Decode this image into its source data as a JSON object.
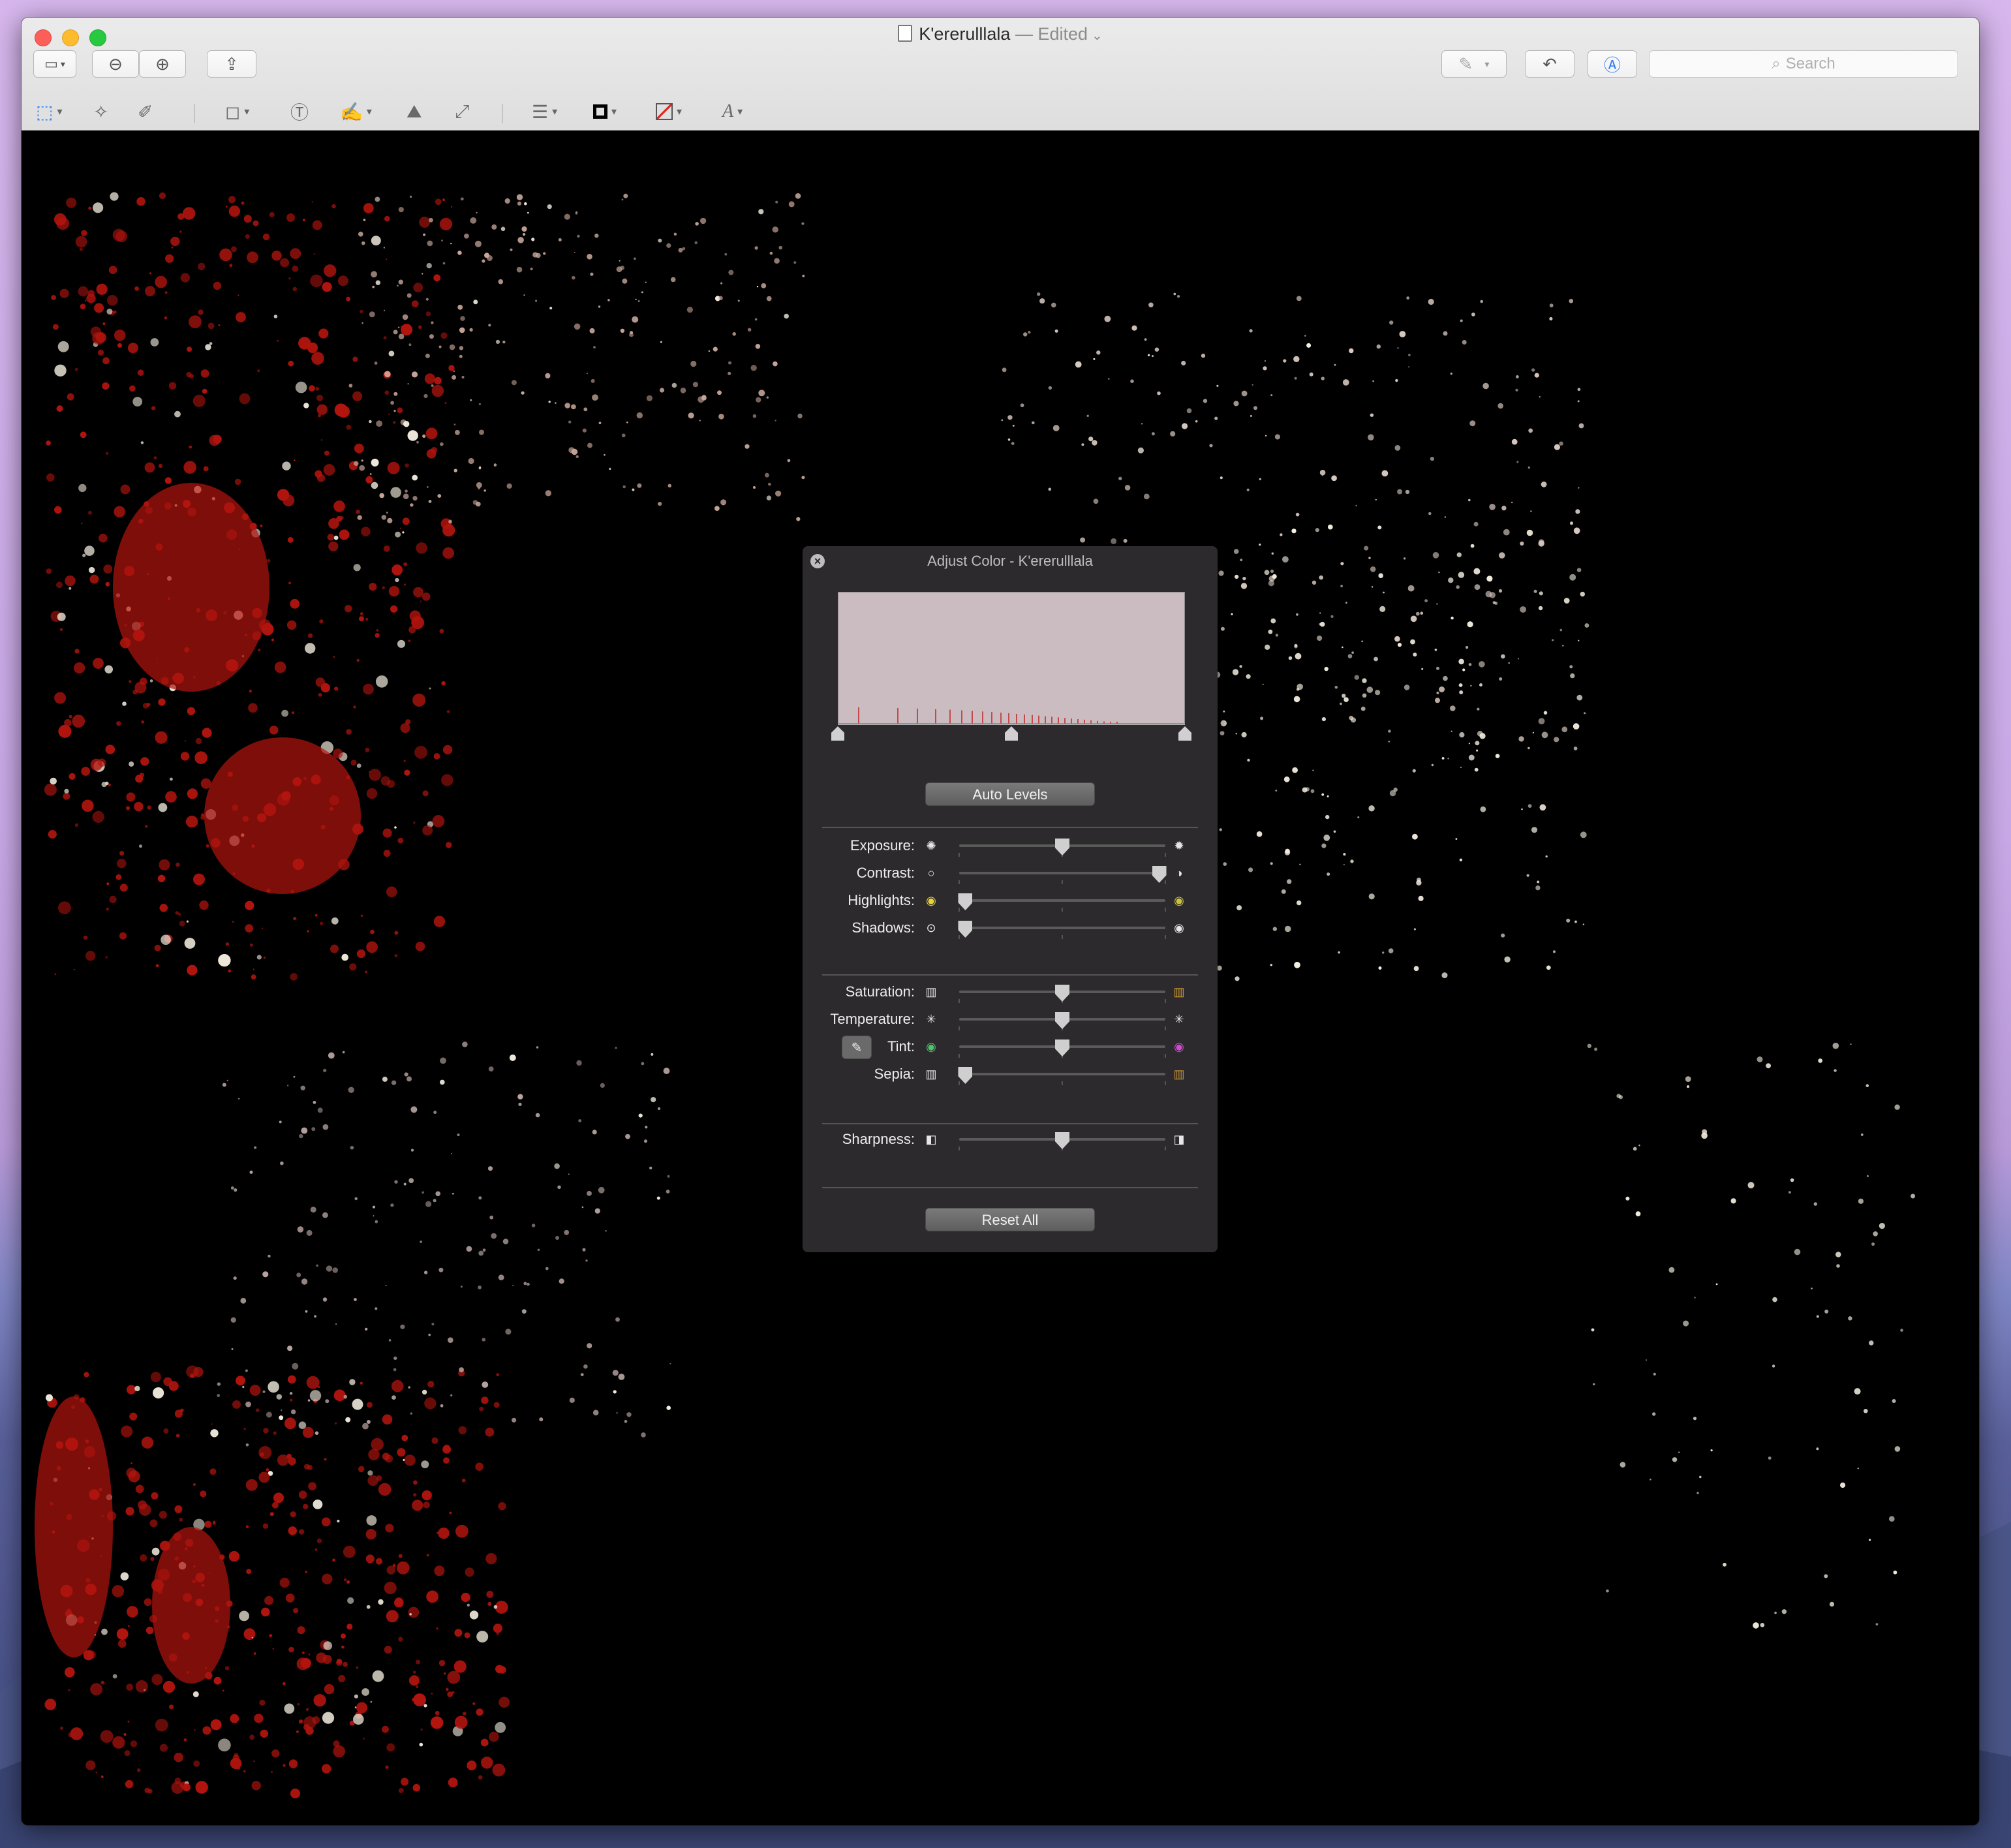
{
  "window": {
    "title": "K'ererulllala",
    "edited_label": "— Edited",
    "search_placeholder": "Search"
  },
  "toolbar": {
    "icons": [
      "sidebar-icon",
      "zoom-out-icon",
      "zoom-in-icon",
      "share-icon",
      "markup-pen-icon",
      "rotate-icon",
      "markup-toolbar-icon"
    ],
    "tools": [
      "rect-select-icon",
      "instant-alpha-icon",
      "sketch-icon",
      "shapes-icon",
      "text-icon",
      "sign-icon",
      "adjust-color-icon",
      "adjust-size-icon",
      "shape-style-icon",
      "border-color-icon",
      "fill-color-icon",
      "text-style-icon"
    ]
  },
  "panel": {
    "title": "Adjust Color - K'ererulllala",
    "auto_levels": "Auto Levels",
    "reset_all": "Reset All",
    "groups": [
      [
        {
          "label": "Exposure:",
          "value": 0.5,
          "icon_left": "exposure-low-icon",
          "icon_right": "exposure-high-icon"
        },
        {
          "label": "Contrast:",
          "value": 0.97,
          "icon_left": "contrast-low-icon",
          "icon_right": "contrast-high-icon"
        },
        {
          "label": "Highlights:",
          "value": 0.03,
          "icon_left": "highlights-low-icon",
          "icon_right": "highlights-high-icon"
        },
        {
          "label": "Shadows:",
          "value": 0.03,
          "icon_left": "shadows-low-icon",
          "icon_right": "shadows-high-icon"
        }
      ],
      [
        {
          "label": "Saturation:",
          "value": 0.5,
          "icon_left": "saturation-low-icon",
          "icon_right": "saturation-high-icon"
        },
        {
          "label": "Temperature:",
          "value": 0.5,
          "icon_left": "temperature-cool-icon",
          "icon_right": "temperature-warm-icon"
        },
        {
          "label": "Tint:",
          "value": 0.5,
          "icon_left": "tint-green-icon",
          "icon_right": "tint-magenta-icon"
        },
        {
          "label": "Sepia:",
          "value": 0.03,
          "icon_left": "sepia-low-icon",
          "icon_right": "sepia-high-icon"
        }
      ],
      [
        {
          "label": "Sharpness:",
          "value": 0.5,
          "icon_left": "sharpness-low-icon",
          "icon_right": "sharpness-high-icon"
        }
      ]
    ],
    "levels": {
      "black": 0.0,
      "mid": 0.5,
      "white": 1.0
    }
  },
  "colors": {
    "photo_red": "#b2140e",
    "photo_white": "#f4eedf",
    "panel_bg": "#2d2a2e"
  }
}
